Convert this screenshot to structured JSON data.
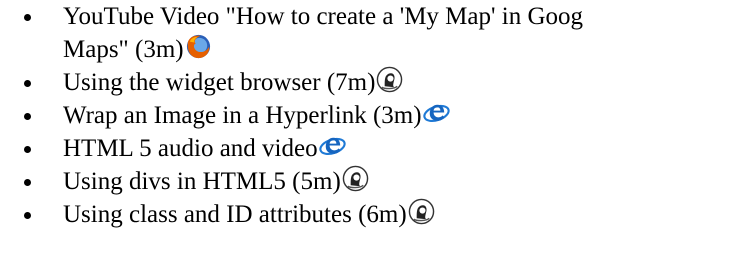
{
  "items": [
    {
      "line1": "YouTube Video \"How to create a 'My Map' in Goog",
      "line2": "Maps\" (3m)",
      "icon": "firefox-icon"
    },
    {
      "text": "Using the widget browser (7m)",
      "icon": "lynda-icon"
    },
    {
      "text": "Wrap an Image in a Hyperlink (3m)",
      "icon": "internet-explorer-icon"
    },
    {
      "text": "HTML 5 audio and video",
      "icon": "internet-explorer-icon"
    },
    {
      "text": "Using divs in HTML5 (5m)",
      "icon": "lynda-icon"
    },
    {
      "text": "Using class and ID attributes (6m)",
      "icon": "lynda-icon"
    }
  ]
}
